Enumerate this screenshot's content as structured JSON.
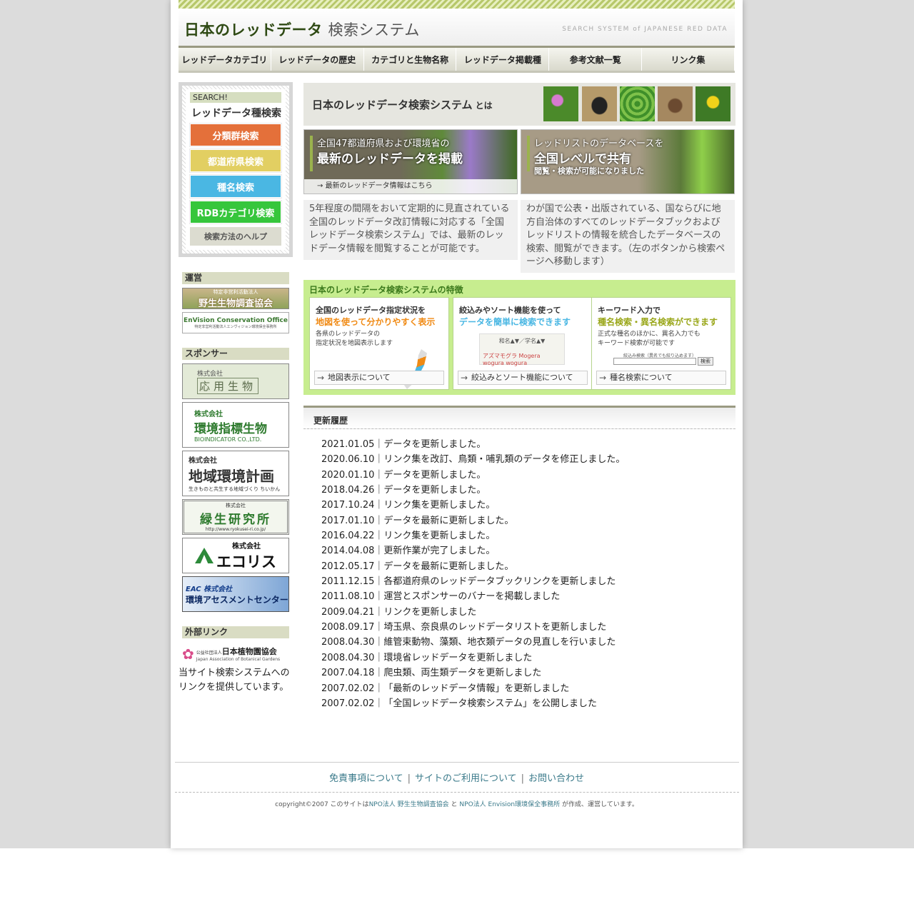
{
  "header": {
    "title_main": "日本のレッドデータ",
    "title_sub": "検索システム",
    "title_en": "SEARCH SYSTEM of JAPANESE RED DATA"
  },
  "nav": {
    "items": [
      {
        "label": "レッドデータカテゴリ"
      },
      {
        "label": "レッドデータの歴史"
      },
      {
        "label": "カテゴリと生物名称"
      },
      {
        "label": "レッドデータ掲載種"
      },
      {
        "label": "参考文献一覧"
      },
      {
        "label": "リンク集"
      }
    ]
  },
  "search": {
    "tag": "SEARCH!",
    "title": "レッドデータ種検索",
    "buttons": [
      {
        "label": "分類群検索",
        "color": "#e4703a"
      },
      {
        "label": "都道府県検索",
        "color": "#e2cf62"
      },
      {
        "label": "種名検索",
        "color": "#4ab7e3"
      },
      {
        "label": "RDBカテゴリ検索",
        "color": "#36c63c"
      }
    ],
    "help": "検索方法のヘルプ"
  },
  "sidebar": {
    "operation_label": "運営",
    "operation_banners": [
      {
        "small": "特定非営利活動法人",
        "text": "野生生物調査協会"
      },
      {
        "text": "EnVision Conservation Office",
        "small": "特定非営利活動法人エンヴィジョン環境保全事務所"
      }
    ],
    "sponsor_label": "スポンサー",
    "sponsor_banners": [
      {
        "small": "株式会社",
        "text": "応用生物"
      },
      {
        "small": "株式会社",
        "text": "環境指標生物",
        "sub": "BIOINDICATOR CO.,LTD."
      },
      {
        "small": "株式会社",
        "text": "地域環境計画",
        "sub": "生きものと共生する地域づくり ちいかん"
      },
      {
        "small": "株式会社",
        "text": "緑生研究所",
        "sub": "http://www.ryokusei-ri.co.jp/"
      },
      {
        "small": "株式会社",
        "text": "エコリス"
      },
      {
        "small": "EAC 株式会社",
        "text": "環境アセスメントセンター"
      }
    ],
    "external_label": "外部リンク",
    "external_banner": {
      "text": "日本植物園協会",
      "small": "公益社団法人",
      "sub": "Japan Association of Botanical Gardens"
    },
    "external_note": "当サイト検索システムへのリンクを提供しています。"
  },
  "main": {
    "intro_title": "日本のレッドデータ検索システム",
    "intro_suffix": "とは",
    "feature_left": {
      "line1": "全国47都道府県および環境省の",
      "line2": "最新のレッドデータを掲載",
      "foot": "最新のレッドデータ情報はこちら",
      "desc": "5年程度の間隔をおいて定期的に見直されている全国のレッドデータ改訂情報に対応する「全国レッドデータ検索システム」では、最新のレッドデータ情報を閲覧することが可能です。"
    },
    "feature_right": {
      "line1": "レッドリストのデータベースを",
      "line2": "全国レベルで共有",
      "line3": "閲覧・検索が可能になりました",
      "desc": "わが国で公表・出版されている、国ならびに地方自治体のすべてのレッドデータブックおよびレッドリストの情報を統合したデータベースの検索、閲覧ができます。（左のボタンから検索ページへ移動します）"
    },
    "features_title": "日本のレッドデータ検索システムの特徴",
    "cards": [
      {
        "h1": "全国のレッドデータ指定状況を",
        "h2": "地図を使って分かりやすく表示",
        "body1": "各県のレッドデータの",
        "body2": "指定状況を地図表示します",
        "link": "地図表示について"
      },
      {
        "h1": "絞込みやソート機能を使って",
        "h2": "データを簡単に検索できます",
        "body1": "和名▲▼／学名▲▼",
        "body2": "アズマモグラ Mogera wogura wogura",
        "link": "絞込みとソート機能について"
      },
      {
        "h1": "キーワード入力で",
        "h2": "種名検索・異名検索ができます",
        "body1": "正式な種名のほかに、異名入力でも",
        "body2": "キーワード検索が可能です",
        "mini_label": "絞込み検索（異名でも絞り込めます）",
        "mini_button": "検索",
        "link": "種名検索について"
      }
    ]
  },
  "updates": {
    "title": "更新履歴",
    "items": [
      "2021.01.05｜データを更新しました。",
      "2020.06.10｜リンク集を改訂、鳥類・哺乳類のデータを修正しました。",
      "2020.01.10｜データを更新しました。",
      "2018.04.26｜データを更新しました。",
      "2017.10.24｜リンク集を更新しました。",
      "2017.01.10｜データを最新に更新しました。",
      "2016.04.22｜リンク集を更新しました。",
      "2014.04.08｜更新作業が完了しました。",
      "2012.05.17｜データを最新に更新しました。",
      "2011.12.15｜各都道府県のレッドデータブックリンクを更新しました",
      "2011.08.10｜運営とスポンサーのバナーを掲載しました",
      "2009.04.21｜リンクを更新しました",
      "2008.09.17｜埼玉県、奈良県のレッドデータリストを更新しました",
      "2008.04.30｜維管束動物、藻類、地衣類データの見直しを行いました",
      "2008.04.30｜環境省レッドデータを更新しました",
      "2007.04.18｜爬虫類、両生類データを更新しました",
      "2007.02.02｜「最新のレッドデータ情報」を更新しました",
      "2007.02.02｜「全国レッドデータ検索システム」を公開しました"
    ]
  },
  "footer": {
    "links": [
      "免責事項について",
      "サイトのご利用について",
      "お問い合わせ"
    ],
    "separator": "|",
    "copyright_pre": "copyright©2007 このサイトは",
    "copyright_org1": "NPO法人 野生生物調査協会",
    "copyright_mid": " と ",
    "copyright_org2": "NPO法人 Envision環境保全事務所",
    "copyright_post": " が作成、運営しています。"
  }
}
